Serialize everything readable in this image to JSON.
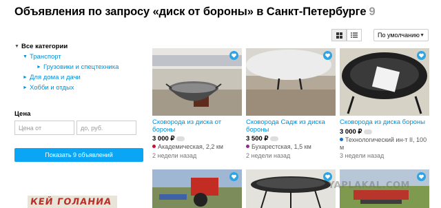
{
  "page": {
    "title": "Объявления по запросу «диск от бороны» в Санкт-Петербурге",
    "count": "9"
  },
  "sidebar": {
    "categories": [
      {
        "label": "Все категории"
      },
      {
        "label": "Транспорт"
      },
      {
        "label": "Грузовики и спецтехника"
      },
      {
        "label": "Для дома и дачи"
      },
      {
        "label": "Хобби и отдых"
      }
    ]
  },
  "price_filter": {
    "label": "Цена",
    "from_placeholder": "Цена от",
    "to_placeholder": "до, руб.",
    "show_button": "Показать 9 объявлений"
  },
  "banner": {
    "text": "КЕЙ ГОЛАНИА"
  },
  "toolbar": {
    "view_grid_icon": "grid-icon",
    "view_list_icon": "list-icon",
    "sort_label": "По умолчанию"
  },
  "colors": {
    "link": "#0091d9",
    "button": "#0aa5f5",
    "metro_red": "#c8102e",
    "metro_purple": "#8e2b8a",
    "metro_blue": "#1a6fc4"
  },
  "listings": [
    {
      "title": "Сковорода из диска от бороны",
      "price": "3 000",
      "currency": "₽",
      "metro_color": "#c8102e",
      "location": "Академическая, 2,2 км",
      "date": "2 недели назад"
    },
    {
      "title": "Сковорода Садж из диска бороны",
      "price": "3 500",
      "currency": "₽",
      "metro_color": "#8e2b8a",
      "location": "Бухарестская, 1,5 км",
      "date": "2 недели назад"
    },
    {
      "title": "Сковорода из диска бороны",
      "price": "3 000",
      "currency": "₽",
      "metro_color": "#1a6fc4",
      "location": "Технологический ин-т II, 100 м",
      "date": "3 недели назад"
    }
  ],
  "watermark": "YAPLAKAL.COM"
}
